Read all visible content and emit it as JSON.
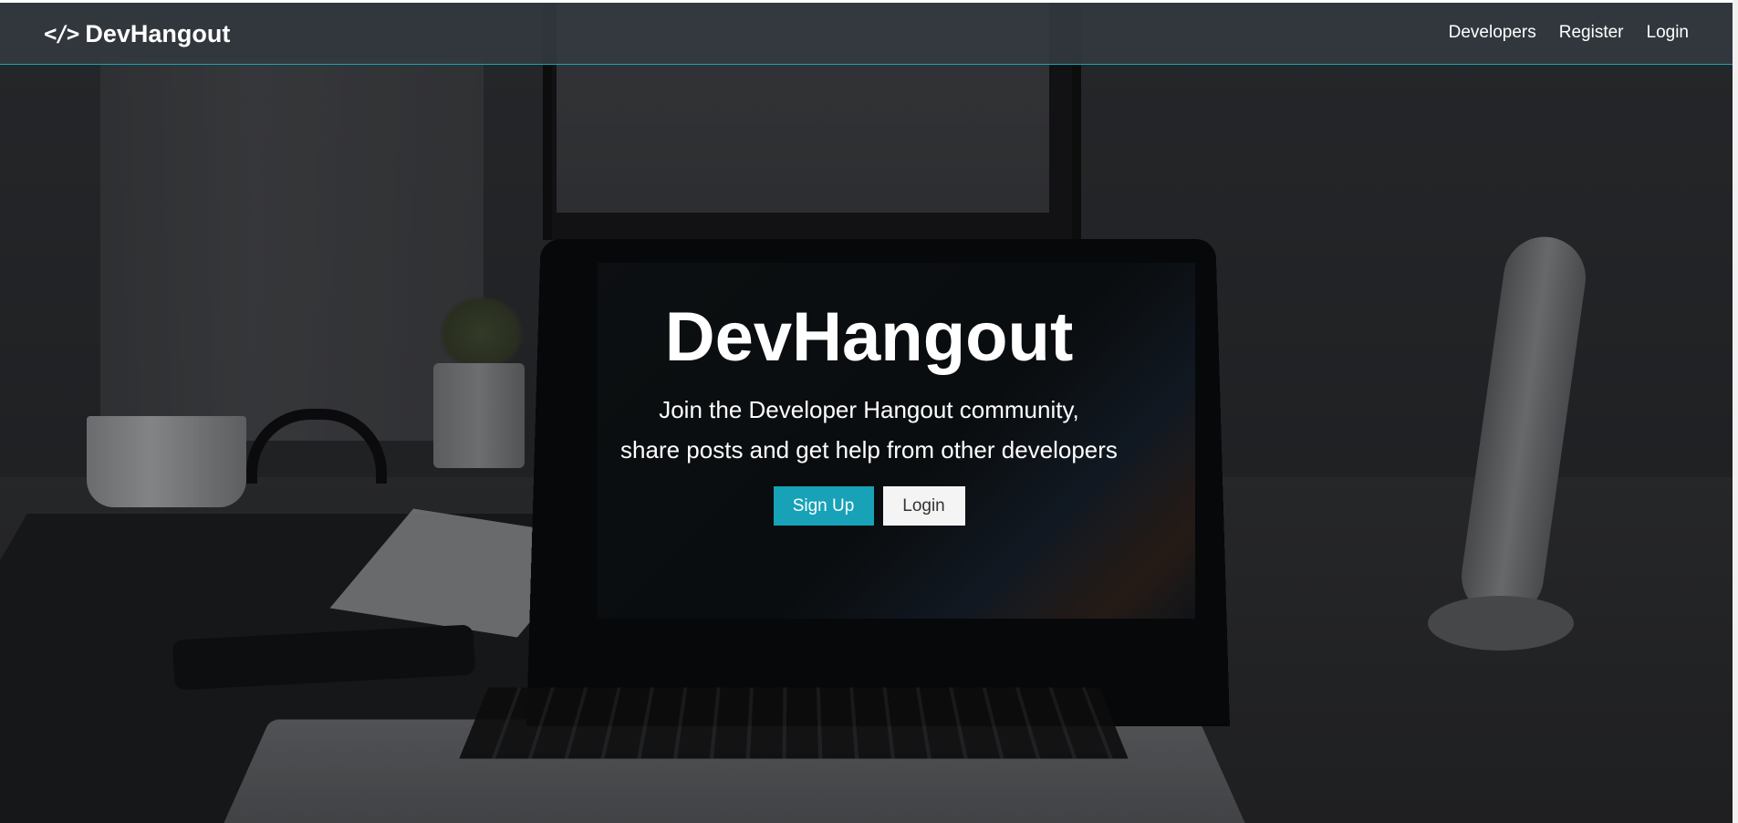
{
  "navbar": {
    "brand_icon": "</>",
    "brand_text": "DevHangout",
    "links": [
      "Developers",
      "Register",
      "Login"
    ]
  },
  "landing": {
    "title": "DevHangout",
    "lead_line1": "Join the Developer Hangout community,",
    "lead_line2": "share posts and get help from other developers",
    "signup_label": "Sign Up",
    "login_label": "Login"
  },
  "colors": {
    "accent": "#17a2b8",
    "navbar_bg": "#343a40",
    "light_button": "#f4f4f4"
  },
  "icons": {
    "brand": "code-icon"
  }
}
